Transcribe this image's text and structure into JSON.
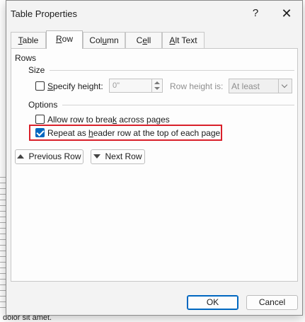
{
  "background": {
    "doc_text": "dolor sit amet."
  },
  "dialog": {
    "title": "Table Properties",
    "help_glyph": "?",
    "close_glyph": "✕"
  },
  "tabs": [
    {
      "label": "Table",
      "mnemonic": "T",
      "rest": "able",
      "active": false
    },
    {
      "label": "Row",
      "mnemonic": "R",
      "rest": "ow",
      "active": true
    },
    {
      "label": "Column",
      "pre": "Col",
      "mnemonic": "u",
      "rest": "mn",
      "active": false
    },
    {
      "label": "Cell",
      "pre": "C",
      "mnemonic": "e",
      "rest": "ll",
      "active": false
    },
    {
      "label": "Alt Text",
      "pre": "",
      "mnemonic": "A",
      "rest": "lt Text",
      "active": false
    }
  ],
  "row_tab": {
    "rows_heading": "Rows",
    "size_heading": "Size",
    "specify_height": {
      "mnemonic": "S",
      "rest": "pecify height:",
      "checked": false
    },
    "height_value": "0\"",
    "row_height_is_label": "Row height is:",
    "row_height_is_value": "At least",
    "options_heading": "Options",
    "allow_break": {
      "pre": "Allow row to brea",
      "mnemonic": "k",
      "rest": " across pages",
      "checked": false
    },
    "repeat_header": {
      "pre": "Repeat as ",
      "mnemonic": "h",
      "rest": "eader row at the top of each page",
      "checked": true
    },
    "previous_row": {
      "mnemonic": "P",
      "rest": "revious Row"
    },
    "next_row": {
      "mnemonic": "N",
      "rest": "ext Row"
    }
  },
  "footer": {
    "ok_label": "OK",
    "cancel_label": "Cancel"
  },
  "colors": {
    "accent": "#0067c0",
    "highlight": "#d9202a"
  }
}
